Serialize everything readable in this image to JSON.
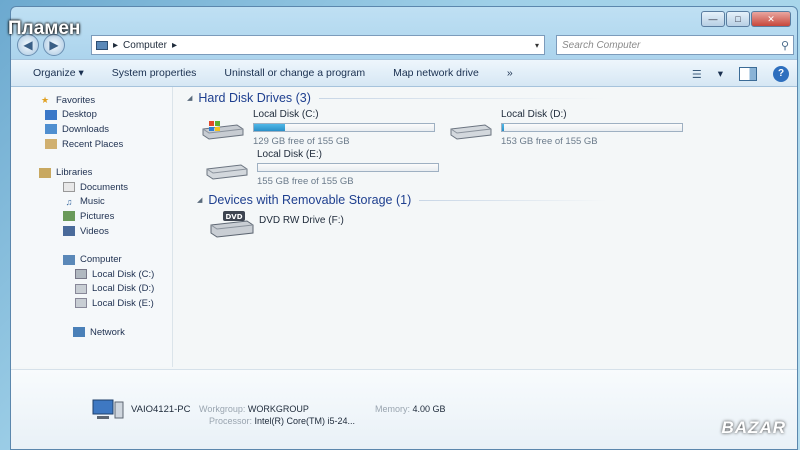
{
  "overlay": {
    "top_label": "Пламен",
    "bottom_label": "BAZAR"
  },
  "address": {
    "crumb_arrow": "▸",
    "path": "Computer",
    "trail_arrow": "▸",
    "dropdown": "▾"
  },
  "search": {
    "placeholder": "Search Computer"
  },
  "toolbar": {
    "organize": "Organize ▾",
    "system_properties": "System properties",
    "uninstall": "Uninstall or change a program",
    "map_network": "Map network drive",
    "more": "»",
    "views_dropdown": "▾"
  },
  "nav": {
    "favorites": "Favorites",
    "desktop": "Desktop",
    "downloads": "Downloads",
    "recent": "Recent Places",
    "libraries": "Libraries",
    "documents": "Documents",
    "music": "Music",
    "pictures": "Pictures",
    "videos": "Videos",
    "computer": "Computer",
    "disk_c": "Local Disk (C:)",
    "disk_d": "Local Disk (D:)",
    "disk_e": "Local Disk (E:)",
    "network": "Network"
  },
  "groups": {
    "hdd": "Hard Disk Drives (3)",
    "removable": "Devices with Removable Storage (1)"
  },
  "drives": [
    {
      "name": "Local Disk (C:)",
      "free": "129 GB free of 155 GB",
      "used_fraction": 0.17
    },
    {
      "name": "Local Disk (D:)",
      "free": "153 GB free of 155 GB",
      "used_fraction": 0.013
    },
    {
      "name": "Local Disk (E:)",
      "free": "155 GB free of 155 GB",
      "used_fraction": 0.0
    }
  ],
  "dvd": {
    "name": "DVD RW Drive (F:)",
    "icon_text": "DVD"
  },
  "details": {
    "pc_name": "VAIO4121-PC",
    "workgroup_label": "Workgroup:",
    "workgroup_value": "WORKGROUP",
    "memory_label": "Memory:",
    "memory_value": "4.00 GB",
    "processor_label": "Processor:",
    "processor_value": "Intel(R) Core(TM) i5-24..."
  }
}
